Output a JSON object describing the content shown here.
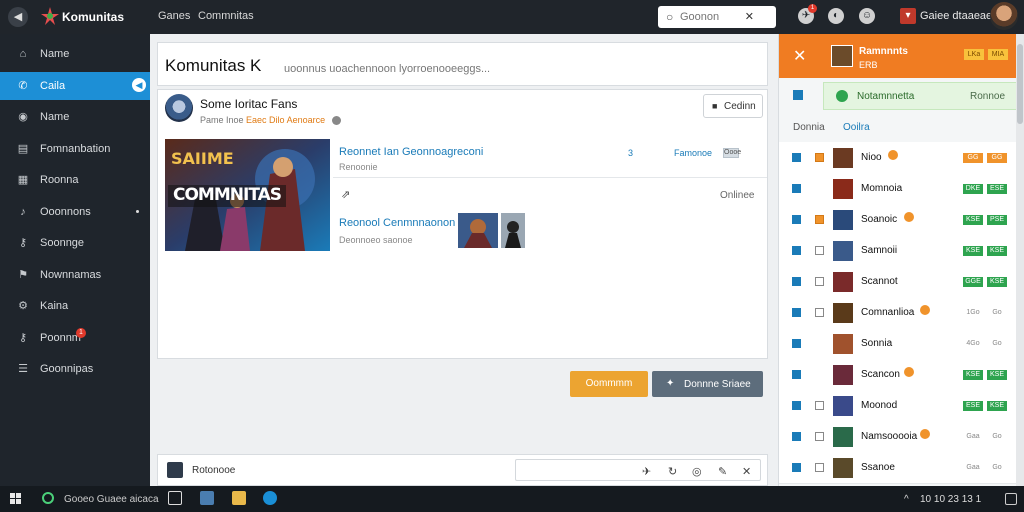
{
  "app": {
    "name": "Komunitas",
    "back_icon": "back-arrow-icon",
    "logo_icon": "komunitas-logo-icon"
  },
  "topnav": {
    "items": [
      "Ganes",
      "Commnitas"
    ]
  },
  "search": {
    "placeholder": "Goonon",
    "value": ""
  },
  "header_user": {
    "name": "Gaiee dtaaeaee",
    "badge_text": "1"
  },
  "sidebar": {
    "items": [
      {
        "label": "Name",
        "icon": "home-icon"
      },
      {
        "label": "Caila",
        "icon": "chat-icon",
        "active": true
      },
      {
        "label": "Name",
        "icon": "globe-icon"
      },
      {
        "label": "Fomnanbation",
        "icon": "document-icon"
      },
      {
        "label": "Roonna",
        "icon": "calendar-icon"
      },
      {
        "label": "Ooonnons",
        "icon": "music-icon"
      },
      {
        "label": "Soonnge",
        "icon": "key-icon"
      },
      {
        "label": "Nownnamas",
        "icon": "flag-icon"
      },
      {
        "label": "Kaina",
        "icon": "gear-icon"
      },
      {
        "label": "Poonnm",
        "icon": "key-icon",
        "badge": "1"
      },
      {
        "label": "Goonnipas",
        "icon": "list-icon"
      }
    ]
  },
  "main": {
    "title": "Komunitas K",
    "subtitle": "uoonnus uoachennoon lyorroenooeeggs...",
    "card": {
      "name": "Some Ioritac Fans",
      "meta_prefix": "Pame Inoe",
      "meta_highlight": "Eaec Dilo Aenoarce",
      "button_label": "Cedinn",
      "banner_text": "COMMNITAS",
      "banner_top_text": "SAIIME",
      "post": {
        "title": "Reonnet Ian Geonnoagreconi",
        "subtitle": "Renoonie",
        "number": "3",
        "right_text": "Famonoe",
        "tag": "Oooe",
        "online": "Onlinee"
      },
      "post2": {
        "title": "Reonool Cenmnnaonon",
        "subtitle": "Deonnoeo saonoe"
      }
    },
    "primary_button": "Oommmm",
    "secondary_button": "Donnne Sriaee",
    "composer_label": "Rotonooe"
  },
  "right_panel": {
    "header": {
      "title": "Ramnnnts",
      "sub": "ERB",
      "tags": [
        "LKa",
        "MIA"
      ]
    },
    "status": {
      "label": "Notamnnetta",
      "right": "Ronnoe"
    },
    "tabs": [
      "Donnia",
      "Ooilra"
    ],
    "rows": [
      {
        "name": "Nioo",
        "square": "orange",
        "badge": true,
        "pills": [
          [
            "orange",
            "GG"
          ],
          [
            "orange",
            "GG"
          ]
        ]
      },
      {
        "name": "Momnoia",
        "square": "none",
        "badge": false,
        "pills": [
          [
            "green",
            "DKE"
          ],
          [
            "green",
            "ESE"
          ]
        ]
      },
      {
        "name": "Soanoic",
        "square": "orange",
        "badge": true,
        "pills": [
          [
            "green",
            "KSE"
          ],
          [
            "green",
            "PSE"
          ]
        ]
      },
      {
        "name": "Samnoii",
        "square": "empty",
        "badge": false,
        "pills": [
          [
            "green",
            "KSE"
          ],
          [
            "green",
            "KSE"
          ]
        ]
      },
      {
        "name": "Scannot",
        "square": "empty",
        "badge": false,
        "pills": [
          [
            "green",
            "GGE"
          ],
          [
            "green",
            "KSE"
          ]
        ]
      },
      {
        "name": "Comnanlioa",
        "square": "empty",
        "badge": true,
        "pills": [
          [
            "text",
            "1Go"
          ],
          [
            "text",
            "Go"
          ]
        ]
      },
      {
        "name": "Sonnia",
        "square": "none",
        "badge": false,
        "pills": [
          [
            "text",
            "4Go"
          ],
          [
            "text",
            "Go"
          ]
        ]
      },
      {
        "name": "Scancon",
        "square": "none",
        "badge": true,
        "pills": [
          [
            "green",
            "KSE"
          ],
          [
            "green",
            "KSE"
          ]
        ]
      },
      {
        "name": "Moonod",
        "square": "empty",
        "badge": false,
        "pills": [
          [
            "green",
            "ESE"
          ],
          [
            "green",
            "KSE"
          ]
        ]
      },
      {
        "name": "Namsooooia",
        "square": "empty",
        "badge": true,
        "pills": [
          [
            "text",
            "Gaa"
          ],
          [
            "text",
            "Go"
          ]
        ]
      },
      {
        "name": "Ssanoe",
        "square": "empty",
        "badge": false,
        "pills": [
          [
            "text",
            "Gaa"
          ],
          [
            "text",
            "Go"
          ]
        ]
      }
    ]
  },
  "taskbar": {
    "search_label": "Gooeo Guaee aicaca",
    "tray_text": "10 10 23 13 1"
  },
  "colors": {
    "accent_blue": "#1d8fd6",
    "accent_orange": "#f07c22",
    "button_orange": "#eca431",
    "sidebar_bg": "#1f252c"
  }
}
